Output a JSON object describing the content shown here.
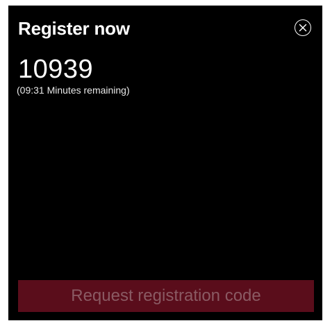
{
  "dialog": {
    "title": "Register now",
    "close_icon": "close-circle-icon",
    "registration_code": "10939",
    "time_remaining": "(09:31 Minutes remaining)",
    "request_button_label": "Request registration code",
    "request_button_disabled": true
  },
  "colors": {
    "background": "#000000",
    "text": "#ffffff",
    "button_background": "#5a0d1b",
    "button_text": "#8a5a63"
  }
}
